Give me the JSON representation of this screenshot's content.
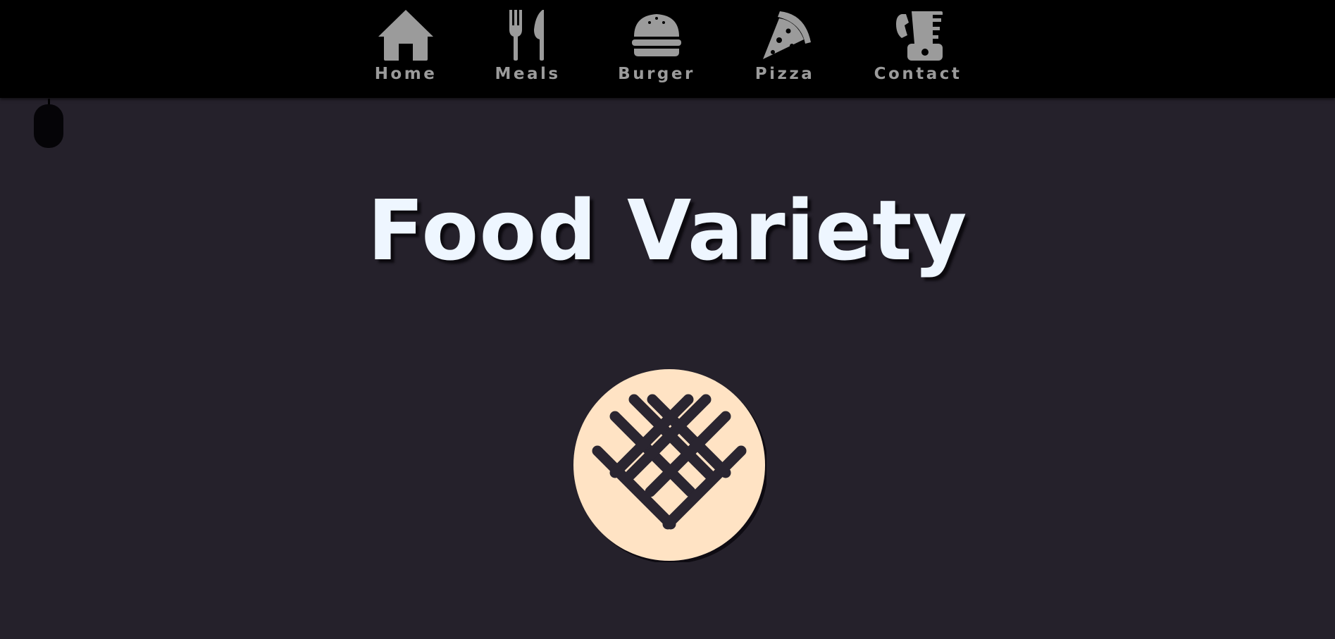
{
  "nav": {
    "items": [
      {
        "label": "Home",
        "icon": "home-icon"
      },
      {
        "label": "Meals",
        "icon": "fork-knife-icon"
      },
      {
        "label": "Burger",
        "icon": "burger-icon"
      },
      {
        "label": "Pizza",
        "icon": "pizza-slice-icon"
      },
      {
        "label": "Contact",
        "icon": "phone-fax-icon"
      }
    ]
  },
  "hero": {
    "title": "Food Variety",
    "badge_icon": "waffle-lattice-icon",
    "scroll_hint_icon": "mouse-icon"
  },
  "colors": {
    "background": "#25212b",
    "navbar": "#000000",
    "nav_text": "#9b9b9b",
    "title": "#eef6ff",
    "badge_fill": "#ffe3c4",
    "badge_lines": "#2a2530"
  }
}
